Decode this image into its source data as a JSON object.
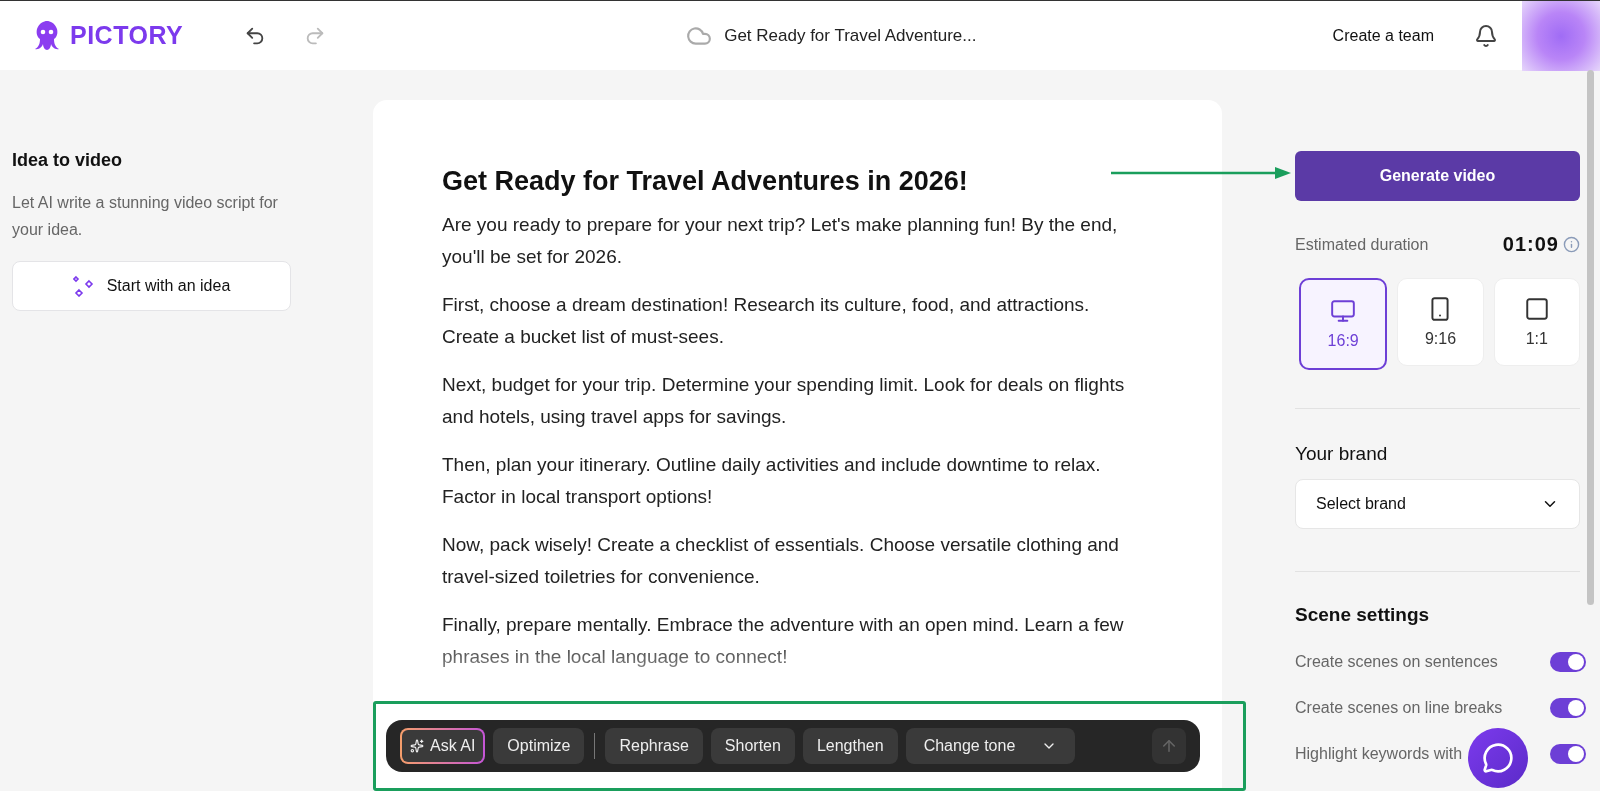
{
  "header": {
    "logo": "PICTORY",
    "project_title": "Get Ready for Travel Adventure...",
    "create_team": "Create a team"
  },
  "sidebar": {
    "title": "Idea to video",
    "description": "Let AI write a stunning video script for your idea.",
    "button": "Start with an idea"
  },
  "script": {
    "title": "Get Ready for Travel Adventures in 2026!",
    "paragraphs": [
      "Are you ready to prepare for your next trip? Let's make planning fun! By the end, you'll be set for 2026.",
      "First, choose a dream destination! Research its culture, food, and attractions. Create a bucket list of must-sees.",
      "Next, budget for your trip. Determine your spending limit. Look for deals on flights and hotels, using travel apps for savings.",
      "Then, plan your itinerary. Outline daily activities and include downtime to relax. Factor in local transport options!",
      "Now, pack wisely! Create a checklist of essentials. Choose versatile clothing and travel-sized toiletries for convenience.",
      "Finally, prepare mentally. Embrace the adventure with an open mind. Learn a few phrases in the local language to connect!"
    ]
  },
  "ai_toolbar": {
    "items": [
      {
        "kind": "ai",
        "label": "Ask AI"
      },
      {
        "kind": "action",
        "label": "Optimize"
      },
      {
        "kind": "separator"
      },
      {
        "kind": "action",
        "label": "Rephrase"
      },
      {
        "kind": "action",
        "label": "Shorten"
      },
      {
        "kind": "action",
        "label": "Lengthen"
      },
      {
        "kind": "dropdown",
        "label": "Change tone"
      },
      {
        "kind": "send",
        "disabled": true
      }
    ]
  },
  "settings": {
    "generate_button": "Generate video",
    "duration_label": "Estimated duration",
    "duration": "01:09",
    "aspect_ratios": [
      {
        "kind": "landscape",
        "label": "16:9",
        "selected": true
      },
      {
        "kind": "portrait",
        "label": "9:16",
        "selected": false
      },
      {
        "kind": "square",
        "label": "1:1",
        "selected": false
      }
    ],
    "brand_title": "Your brand",
    "brand_select": "Select brand",
    "scene_title": "Scene settings",
    "toggles": [
      {
        "label": "Create scenes on sentences",
        "on": true
      },
      {
        "label": "Create scenes on line breaks",
        "on": true
      },
      {
        "label": "Highlight keywords with",
        "on": true
      }
    ]
  }
}
